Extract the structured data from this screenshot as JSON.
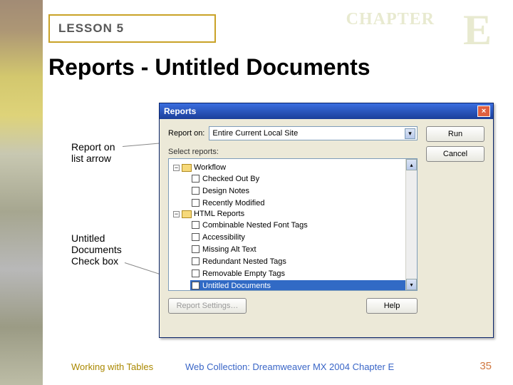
{
  "header": {
    "lesson": "LESSON 5",
    "chapter_label": "CHAPTER",
    "chapter_letter": "E"
  },
  "slide_title": "Reports - Untitled Documents",
  "callouts": {
    "arrow_label": "Report on\nlist arrow",
    "checkbox_label": "Untitled\nDocuments\nCheck box"
  },
  "dialog": {
    "title": "Reports",
    "close": "×",
    "report_on_label": "Report on:",
    "report_on_value": "Entire Current Local Site",
    "select_reports_label": "Select reports:",
    "groups": [
      {
        "name": "Workflow",
        "items": [
          {
            "label": "Checked Out By",
            "checked": false,
            "selected": false
          },
          {
            "label": "Design Notes",
            "checked": false,
            "selected": false
          },
          {
            "label": "Recently Modified",
            "checked": false,
            "selected": false
          }
        ]
      },
      {
        "name": "HTML Reports",
        "items": [
          {
            "label": "Combinable Nested Font Tags",
            "checked": false,
            "selected": false
          },
          {
            "label": "Accessibility",
            "checked": false,
            "selected": false
          },
          {
            "label": "Missing Alt Text",
            "checked": false,
            "selected": false
          },
          {
            "label": "Redundant Nested Tags",
            "checked": false,
            "selected": false
          },
          {
            "label": "Removable Empty Tags",
            "checked": false,
            "selected": false
          },
          {
            "label": "Untitled Documents",
            "checked": true,
            "selected": true
          }
        ]
      }
    ],
    "buttons": {
      "run": "Run",
      "cancel": "Cancel",
      "report_settings": "Report Settings…",
      "help": "Help"
    }
  },
  "footer": {
    "left": "Working with Tables",
    "center": "Web Collection: Dreamweaver MX 2004 Chapter E",
    "page": "35"
  }
}
